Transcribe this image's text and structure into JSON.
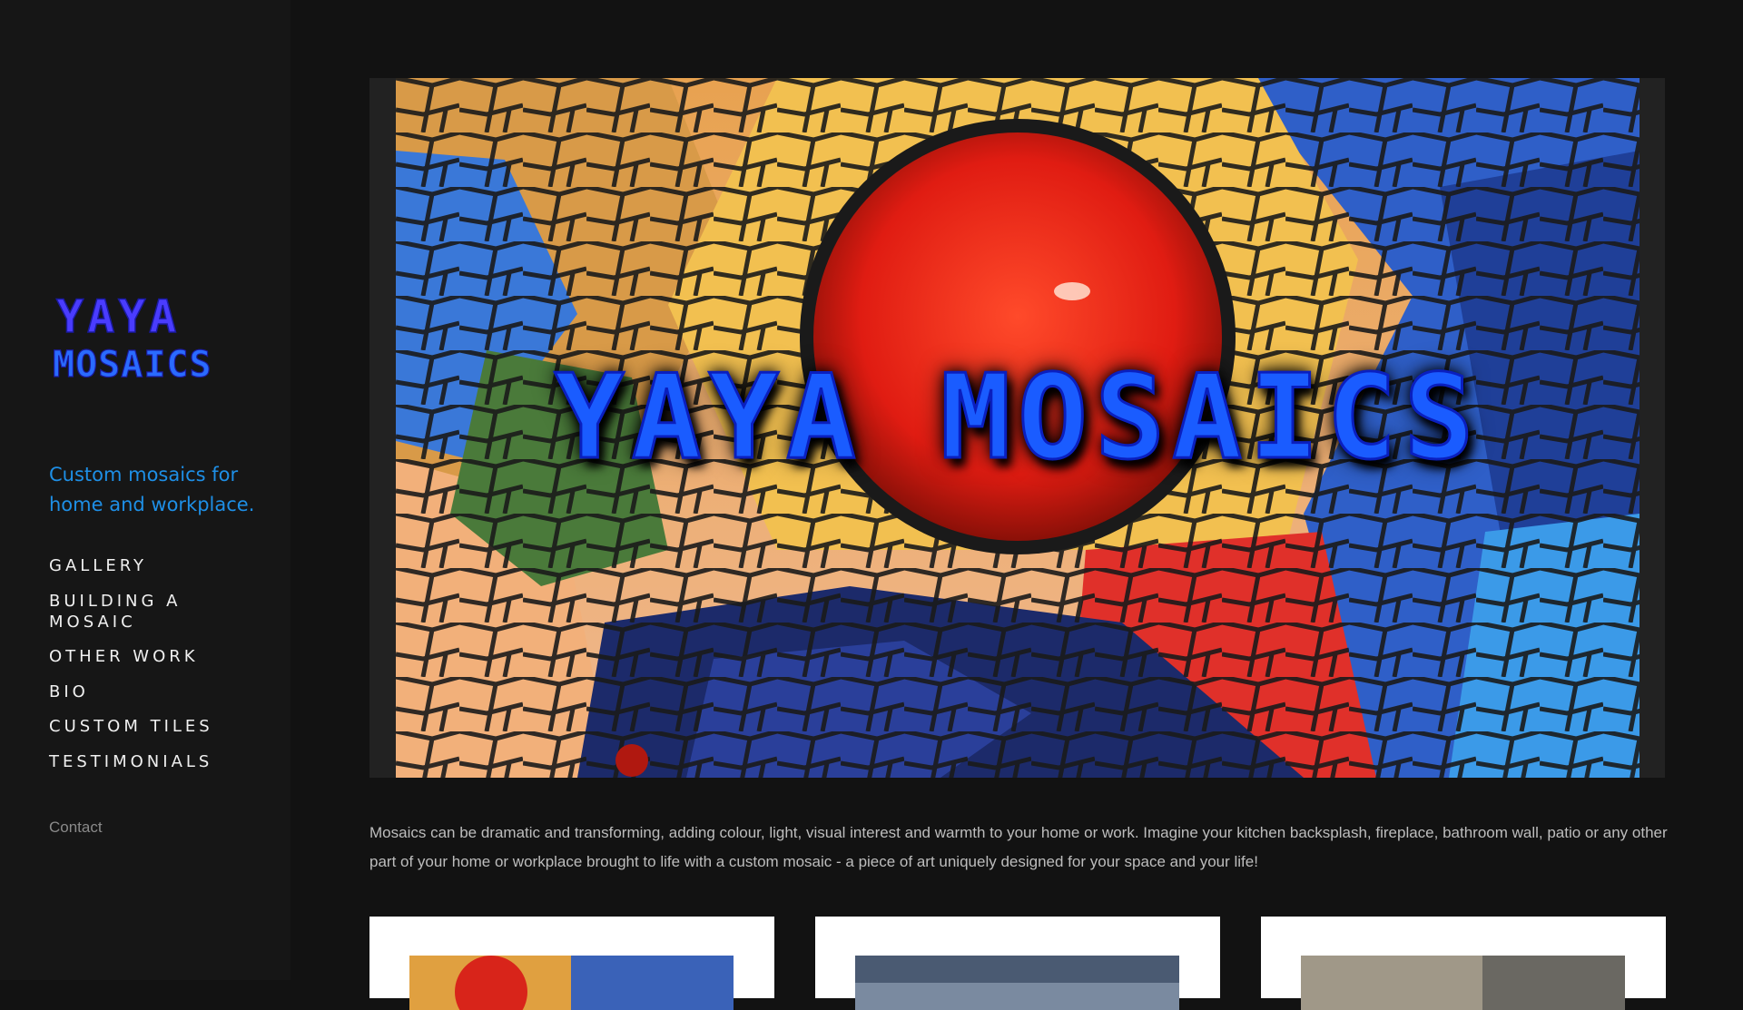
{
  "logo": {
    "line1": "YAYA",
    "line2": "MOSAICS"
  },
  "tagline": "Custom mosaics for home and workplace.",
  "nav": [
    {
      "label": "GALLERY"
    },
    {
      "label": "BUILDING A MOSAIC"
    },
    {
      "label": "OTHER WORK"
    },
    {
      "label": "BIO"
    },
    {
      "label": "CUSTOM TILES"
    },
    {
      "label": "TESTIMONIALS"
    }
  ],
  "contact": "Contact",
  "hero": {
    "title": "YAYA MOSAICS"
  },
  "intro": "Mosaics can be dramatic and transforming, adding colour, light, visual interest and warmth to your home or work.  Imagine your kitchen backsplash, fireplace, bathroom wall, patio or any other part of your home or workplace brought to life with a custom mosaic - a piece of art uniquely designed for your space and your life!",
  "colors": {
    "accent": "#1e8fe6",
    "background": "#121212",
    "logo_blue": "#2a3bff"
  }
}
